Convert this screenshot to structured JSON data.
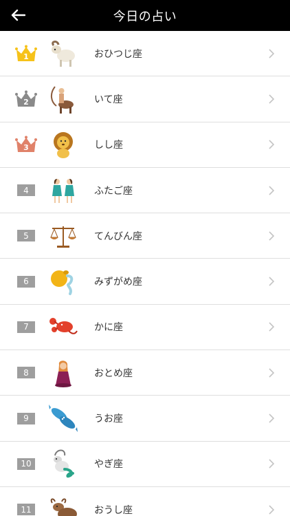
{
  "header": {
    "title": "今日の占い",
    "back_icon": "back-arrow-icon"
  },
  "colors": {
    "gold": "#f6c21a",
    "silver": "#8a8a8a",
    "bronze": "#e0826a",
    "badge": "#9e9e9e"
  },
  "rankings": [
    {
      "rank": "1",
      "name": "おひつじ座",
      "icon": "aries-icon"
    },
    {
      "rank": "2",
      "name": "いて座",
      "icon": "sagittarius-icon"
    },
    {
      "rank": "3",
      "name": "しし座",
      "icon": "leo-icon"
    },
    {
      "rank": "4",
      "name": "ふたご座",
      "icon": "gemini-icon"
    },
    {
      "rank": "5",
      "name": "てんびん座",
      "icon": "libra-icon"
    },
    {
      "rank": "6",
      "name": "みずがめ座",
      "icon": "aquarius-icon"
    },
    {
      "rank": "7",
      "name": "かに座",
      "icon": "cancer-icon"
    },
    {
      "rank": "8",
      "name": "おとめ座",
      "icon": "virgo-icon"
    },
    {
      "rank": "9",
      "name": "うお座",
      "icon": "pisces-icon"
    },
    {
      "rank": "10",
      "name": "やぎ座",
      "icon": "capricorn-icon"
    },
    {
      "rank": "11",
      "name": "おうし座",
      "icon": "taurus-icon"
    }
  ]
}
